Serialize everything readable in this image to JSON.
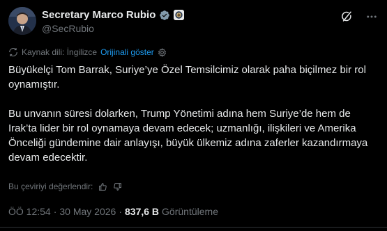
{
  "author": {
    "display_name": "Secretary Marco Rubio",
    "handle": "@SecRubio"
  },
  "icons": {
    "verified": "verified-badge-icon",
    "affiliation": "us-state-department-seal-icon",
    "grok": "grok-icon",
    "more": "more-dots-icon",
    "translate": "translate-icon",
    "settings": "gear-icon",
    "thumbs_up": "thumbs-up-icon",
    "thumbs_down": "thumbs-down-icon"
  },
  "colors": {
    "background": "#000000",
    "text_primary": "#e7e9ea",
    "text_secondary": "#71767b",
    "link": "#1d9bf0",
    "verified": "#829aab"
  },
  "translation": {
    "source_label": "Kaynak dili: İngilizce",
    "show_original_label": "Orijinali göster"
  },
  "tweet": {
    "paragraph1": "Büyükelçi Tom Barrak, Suriye’ye Özel Temsilcimiz olarak paha biçilmez bir rol oynamıştır.",
    "paragraph2": "Bu unvanın süresi dolarken, Trump Yönetimi adına hem Suriye’de hem de Irak’ta lider bir rol oynamaya devam edecek; uzmanlığı, ilişkileri ve Amerika Önceliği gündemine dair anlayışı, büyük ülkemiz adına zaferler kazandırmaya devam edecektir."
  },
  "rating": {
    "prompt": "Bu çeviriyi değerlendir:"
  },
  "meta": {
    "time": "ÖÖ 12:54",
    "separator": "·",
    "date": "30 May 2026",
    "separator2": "·",
    "views_count": "837,6 B",
    "views_label": "Görüntüleme"
  }
}
